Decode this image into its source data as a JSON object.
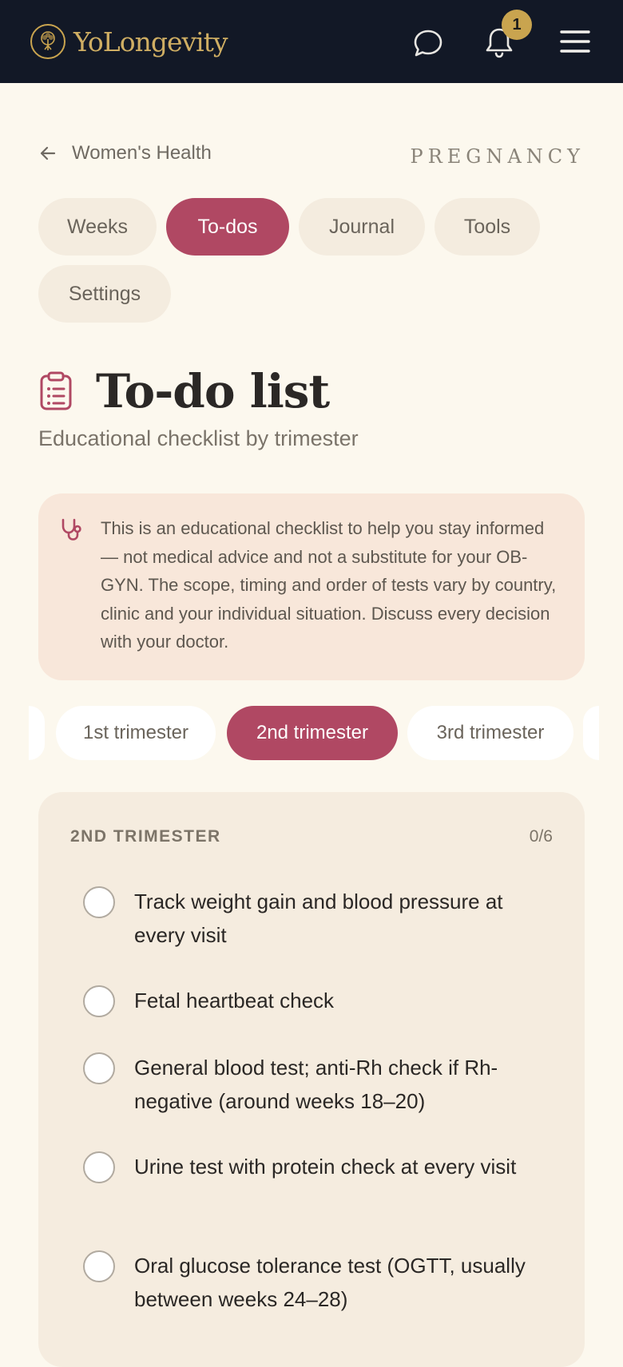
{
  "header": {
    "brand_name": "YoLongevity",
    "notification_count": "1",
    "icons": {
      "logo": "tree-logo-icon",
      "chat": "chat-bubble-icon",
      "bell": "bell-icon",
      "menu": "hamburger-menu-icon"
    },
    "colors": {
      "background": "#121826",
      "brand_gold": "#cfae63"
    }
  },
  "breadcrumb": {
    "back_label": "Women's Health",
    "section": "PREGNANCY"
  },
  "tabs": [
    {
      "label": "Weeks",
      "active": false
    },
    {
      "label": "To-dos",
      "active": true
    },
    {
      "label": "Journal",
      "active": false
    },
    {
      "label": "Tools",
      "active": false
    },
    {
      "label": "Settings",
      "active": false
    }
  ],
  "page": {
    "title": "To-do list",
    "subtitle": "Educational checklist by trimester",
    "title_icon": "clipboard-list-icon"
  },
  "notice": {
    "icon": "stethoscope-icon",
    "text": "This is an educational checklist to help you stay informed — not medical advice and not a substitute for your OB-GYN. The scope, timing and order of tests vary by country, clinic and your individual situation. Discuss every decision with your doctor."
  },
  "trimesters": [
    {
      "label": "1st trimester",
      "active": false
    },
    {
      "label": "2nd trimester",
      "active": true
    },
    {
      "label": "3rd trimester",
      "active": false
    }
  ],
  "checklist": {
    "heading": "2ND TRIMESTER",
    "progress": "0/6",
    "items": [
      {
        "text": "Track weight gain and blood pressure at every visit",
        "checked": false
      },
      {
        "text": "Fetal heartbeat check",
        "checked": false
      },
      {
        "text": "General blood test; anti-Rh check if Rh-negative (around weeks 18–20)",
        "checked": false
      },
      {
        "text": "Urine test with protein check at every visit",
        "checked": false
      },
      {
        "text": "Oral glucose tolerance test (OGTT, usually between weeks 24–28)",
        "checked": false
      }
    ]
  },
  "colors": {
    "accent": "#b04863",
    "page_bg": "#fcf8ee",
    "notice_bg": "#f8e7da",
    "card_bg": "#f5ecdf"
  }
}
